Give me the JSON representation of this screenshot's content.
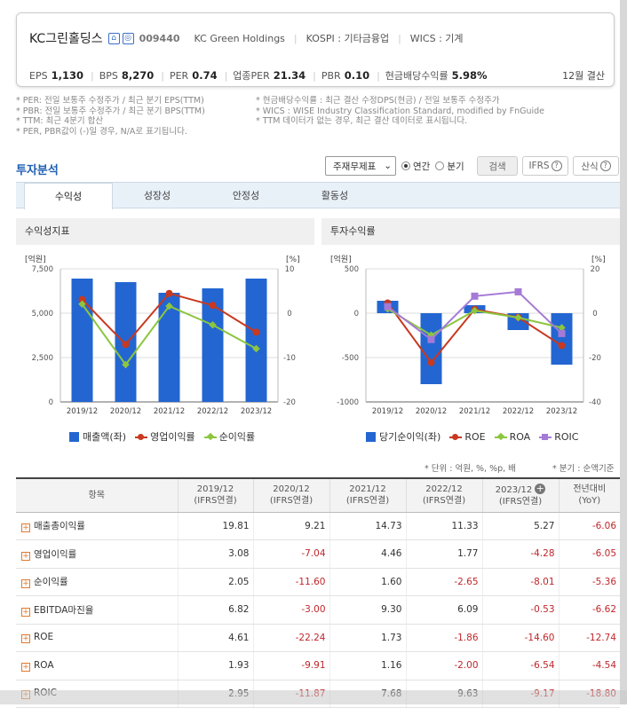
{
  "header": {
    "name": "KC그린홀딩스",
    "code": "009440",
    "eng_name": "KC Green Holdings",
    "market": "KOSPI : 기타금융업",
    "wics": "WICS : 기계",
    "metrics": [
      {
        "label": "EPS",
        "value": "1,130"
      },
      {
        "label": "BPS",
        "value": "8,270"
      },
      {
        "label": "PER",
        "value": "0.74"
      },
      {
        "label": "업종PER",
        "value": "21.34"
      },
      {
        "label": "PBR",
        "value": "0.10"
      },
      {
        "label": "현금배당수익률",
        "value": "5.98%"
      }
    ],
    "settle": "12월 결산"
  },
  "notes_left": [
    "* PER: 전일 보통주 수정주가 / 최근 분기 EPS(TTM)",
    "* PBR: 전일 보통주 수정주가 / 최근 분기 BPS(TTM)",
    "* TTM: 최근 4분기 합산",
    "* PER, PBR값이 (-)일 경우, N/A로 표기됩니다."
  ],
  "notes_right": [
    "* 현금배당수익률 : 최근 결산 수정DPS(현금) / 전일 보통주 수정주가",
    "* WICS : WISE Industry Classification Standard, modified by FnGuide",
    "* TTM 데이터가 없는 경우, 최근 결산 데이터로 표시됩니다."
  ],
  "section_title": "투자분석",
  "controls": {
    "select": "주재무제표",
    "radio_annual": "연간",
    "radio_quarter": "분기",
    "search": "검색",
    "ifrs": "IFRS",
    "formula": "산식"
  },
  "tabs": [
    "수익성",
    "성장성",
    "안정성",
    "활동성"
  ],
  "panel_left_title": "수익성지표",
  "panel_right_title": "투자수익률",
  "chart_data": [
    {
      "type": "bar",
      "title": "수익성지표",
      "categories": [
        "2019/12",
        "2020/12",
        "2021/12",
        "2022/12",
        "2023/12"
      ],
      "left_unit": "[억원]",
      "right_unit": "[%]",
      "ylim_left": [
        0,
        7500
      ],
      "ylim_right": [
        -20,
        10
      ],
      "left_ticks": [
        "7,500",
        "5,000",
        "2,500",
        "0"
      ],
      "right_ticks": [
        "10",
        "0",
        "-10",
        "-20"
      ],
      "series": [
        {
          "name": "매출액(좌)",
          "kind": "bar",
          "axis": "left",
          "color": "#2366d1",
          "values": [
            6950,
            6750,
            6150,
            6400,
            6950
          ]
        },
        {
          "name": "영업이익률",
          "kind": "line",
          "axis": "right",
          "color": "#c8391f",
          "marker": "circle",
          "values": [
            3.08,
            -7.04,
            4.46,
            1.77,
            -4.28
          ]
        },
        {
          "name": "순이익률",
          "kind": "line",
          "axis": "right",
          "color": "#8cc63f",
          "marker": "diamond",
          "values": [
            2.05,
            -11.6,
            1.6,
            -2.65,
            -8.01
          ]
        }
      ]
    },
    {
      "type": "bar",
      "title": "투자수익률",
      "categories": [
        "2019/12",
        "2020/12",
        "2021/12",
        "2022/12",
        "2023/12"
      ],
      "left_unit": "[억원]",
      "right_unit": "[%]",
      "ylim_left": [
        -1000,
        500
      ],
      "ylim_right": [
        -40,
        20
      ],
      "left_ticks": [
        "500",
        "0",
        "-500",
        "-1000"
      ],
      "right_ticks": [
        "20",
        "0",
        "-20",
        "-40"
      ],
      "series": [
        {
          "name": "당기순이익(좌)",
          "kind": "bar",
          "axis": "left",
          "color": "#2366d1",
          "values": [
            140,
            -800,
            90,
            -190,
            -580
          ]
        },
        {
          "name": "ROE",
          "kind": "line",
          "axis": "right",
          "color": "#c8391f",
          "marker": "circle",
          "values": [
            4.61,
            -22.24,
            1.73,
            -1.86,
            -14.6
          ]
        },
        {
          "name": "ROA",
          "kind": "line",
          "axis": "right",
          "color": "#8cc63f",
          "marker": "diamond",
          "values": [
            1.93,
            -9.91,
            1.16,
            -2.0,
            -6.54
          ]
        },
        {
          "name": "ROIC",
          "kind": "line",
          "axis": "right",
          "color": "#a57ad6",
          "marker": "square",
          "values": [
            2.95,
            -11.87,
            7.68,
            9.63,
            -9.17
          ]
        }
      ]
    }
  ],
  "unit_note": "* 단위 : 억원, %, %p, 배",
  "quarter_note": "* 분기 : 순액기준",
  "table": {
    "headers": [
      {
        "top": "항목",
        "bot": ""
      },
      {
        "top": "2019/12",
        "bot": "(IFRS연결)"
      },
      {
        "top": "2020/12",
        "bot": "(IFRS연결)"
      },
      {
        "top": "2021/12",
        "bot": "(IFRS연결)"
      },
      {
        "top": "2022/12",
        "bot": "(IFRS연결)"
      },
      {
        "top": "2023/12",
        "bot": "(IFRS연결)"
      },
      {
        "top": "전년대비",
        "bot": "(YoY)"
      }
    ],
    "rows": [
      {
        "label": "매출총이익률",
        "values": [
          "19.81",
          "9.21",
          "14.73",
          "11.33",
          "5.27",
          "-6.06"
        ]
      },
      {
        "label": "영업이익률",
        "values": [
          "3.08",
          "-7.04",
          "4.46",
          "1.77",
          "-4.28",
          "-6.05"
        ]
      },
      {
        "label": "순이익률",
        "values": [
          "2.05",
          "-11.60",
          "1.60",
          "-2.65",
          "-8.01",
          "-5.36"
        ]
      },
      {
        "label": "EBITDA마진율",
        "values": [
          "6.82",
          "-3.00",
          "9.30",
          "6.09",
          "-0.53",
          "-6.62"
        ]
      },
      {
        "label": "ROE",
        "values": [
          "4.61",
          "-22.24",
          "1.73",
          "-1.86",
          "-14.60",
          "-12.74"
        ]
      },
      {
        "label": "ROA",
        "values": [
          "1.93",
          "-9.91",
          "1.16",
          "-2.00",
          "-6.54",
          "-4.54"
        ]
      },
      {
        "label": "ROIC",
        "values": [
          "2.95",
          "-11.87",
          "7.68",
          "9.63",
          "-9.17",
          "-18.80"
        ]
      }
    ]
  }
}
